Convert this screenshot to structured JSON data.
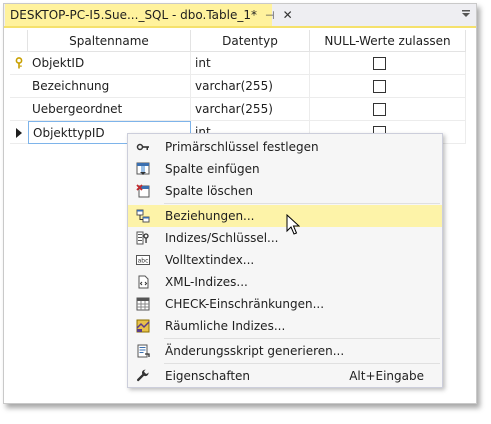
{
  "tab": {
    "title": "DESKTOP-PC-I5.Sue..._SQL - dbo.Table_1*",
    "pin": "⊣",
    "close": "✕"
  },
  "grid": {
    "headers": [
      "Spaltenname",
      "Datentyp",
      "NULL-Werte zulassen"
    ],
    "rows": [
      {
        "name": "ObjektID",
        "type": "int"
      },
      {
        "name": "Bezeichnung",
        "type": "varchar(255)"
      },
      {
        "name": "Uebergeordnet",
        "type": "varchar(255)"
      },
      {
        "name": "ObjekttypID",
        "type": "int"
      }
    ]
  },
  "menu": {
    "items": [
      {
        "label": "Primärschlüssel festlegen",
        "icon": "primary-key-icon"
      },
      {
        "label": "Spalte einfügen",
        "icon": "insert-column-icon"
      },
      {
        "label": "Spalte löschen",
        "icon": "delete-column-icon"
      },
      {
        "label": "Beziehungen...",
        "icon": "relationships-icon"
      },
      {
        "label": "Indizes/Schlüssel...",
        "icon": "indexes-keys-icon"
      },
      {
        "label": "Volltextindex...",
        "icon": "fulltext-index-icon"
      },
      {
        "label": "XML-Indizes...",
        "icon": "xml-index-icon"
      },
      {
        "label": "CHECK-Einschränkungen...",
        "icon": "check-constraint-icon"
      },
      {
        "label": "Räumliche Indizes...",
        "icon": "spatial-index-icon"
      },
      {
        "label": "Änderungsskript generieren...",
        "icon": "generate-script-icon"
      },
      {
        "label": "Eigenschaften",
        "icon": "properties-wrench-icon",
        "shortcut": "Alt+Eingabe"
      }
    ],
    "abc_text": "abc"
  },
  "colors": {
    "tab_active": "#fff29d",
    "menu_highlight": "#fdf3a8",
    "menu_bg": "#f6f6f6"
  }
}
